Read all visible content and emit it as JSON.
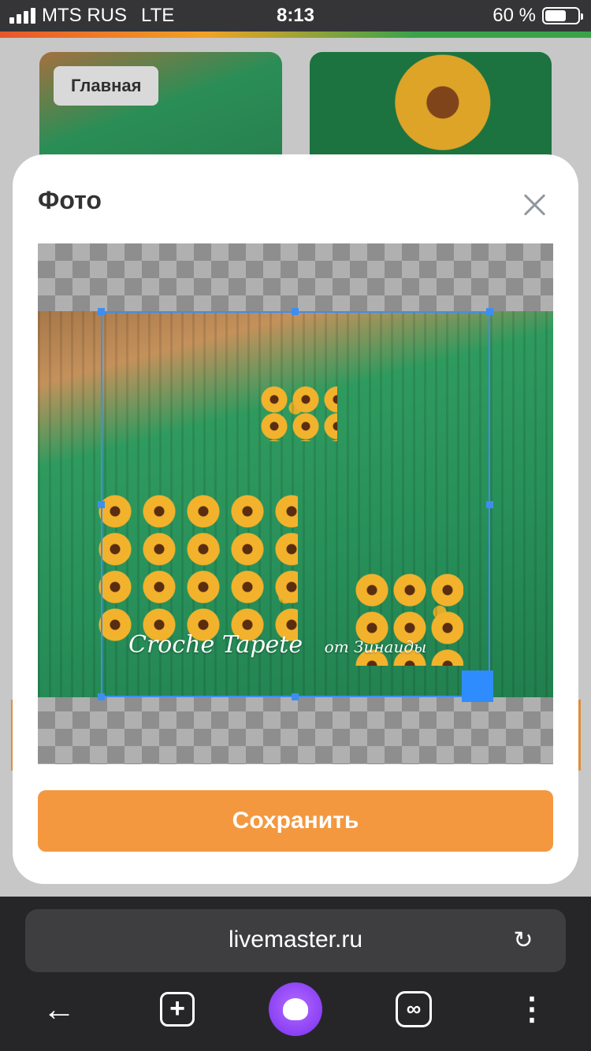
{
  "status_bar": {
    "carrier": "MTS RUS",
    "network": "LTE",
    "time": "8:13",
    "battery": "60 %"
  },
  "background_page": {
    "home_chip": "Главная"
  },
  "modal": {
    "title": "Фото",
    "save_button": "Сохранить",
    "watermark_line1": "Croche Tapete",
    "watermark_line2": "от Зинаиды"
  },
  "browser": {
    "url": "livemaster.ru",
    "icons": [
      "back-arrow-icon",
      "new-tab-icon",
      "alice-assistant-icon",
      "tabs-icon",
      "more-icon",
      "reload-icon"
    ]
  },
  "colors": {
    "accent": "#f4983f",
    "crop_frame": "#3e8ef0",
    "browser_bar": "#262628"
  }
}
